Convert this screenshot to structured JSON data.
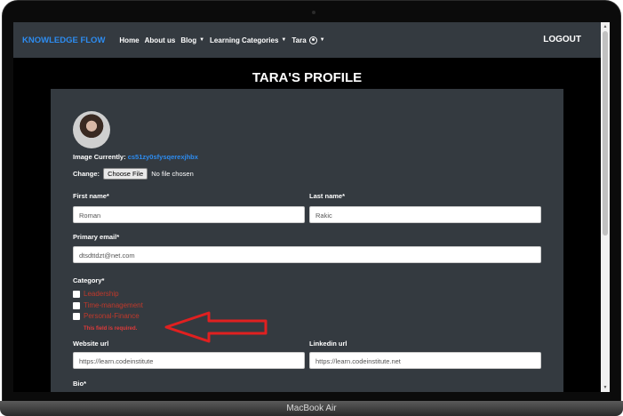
{
  "navbar": {
    "brand": "KNOWLEDGE FLOW",
    "home": "Home",
    "about": "About us",
    "blog": "Blog",
    "learning": "Learning Categories",
    "user": "Tara",
    "logout": "LOGOUT"
  },
  "page": {
    "title": "TARA'S PROFILE"
  },
  "profile": {
    "image_label": "Image Currently:",
    "image_link": "cs51zy0sfysqerexjhbx",
    "change_label": "Change:",
    "choose_file": "Choose File",
    "no_file": "No file chosen",
    "first_name_label": "First name*",
    "first_name_value": "Roman",
    "last_name_label": "Last name*",
    "last_name_value": "Rakic",
    "email_label": "Primary email*",
    "email_value": "dtsdttdzt@net.com",
    "category_label": "Category*",
    "categories": [
      "Leadership",
      "Time-management",
      "Personal-Finance"
    ],
    "error": "This field is required.",
    "website_label": "Website url",
    "website_value": "https://learn.codeinstitute",
    "linkedin_label": "Linkedin url",
    "linkedin_value": "https://learn.codeinstitute.net",
    "bio_label": "Bio*"
  },
  "device": {
    "label": "MacBook Air"
  },
  "colors": {
    "brand": "#2d8cf0",
    "error": "#e03a3a",
    "arrow": "#e02020"
  }
}
